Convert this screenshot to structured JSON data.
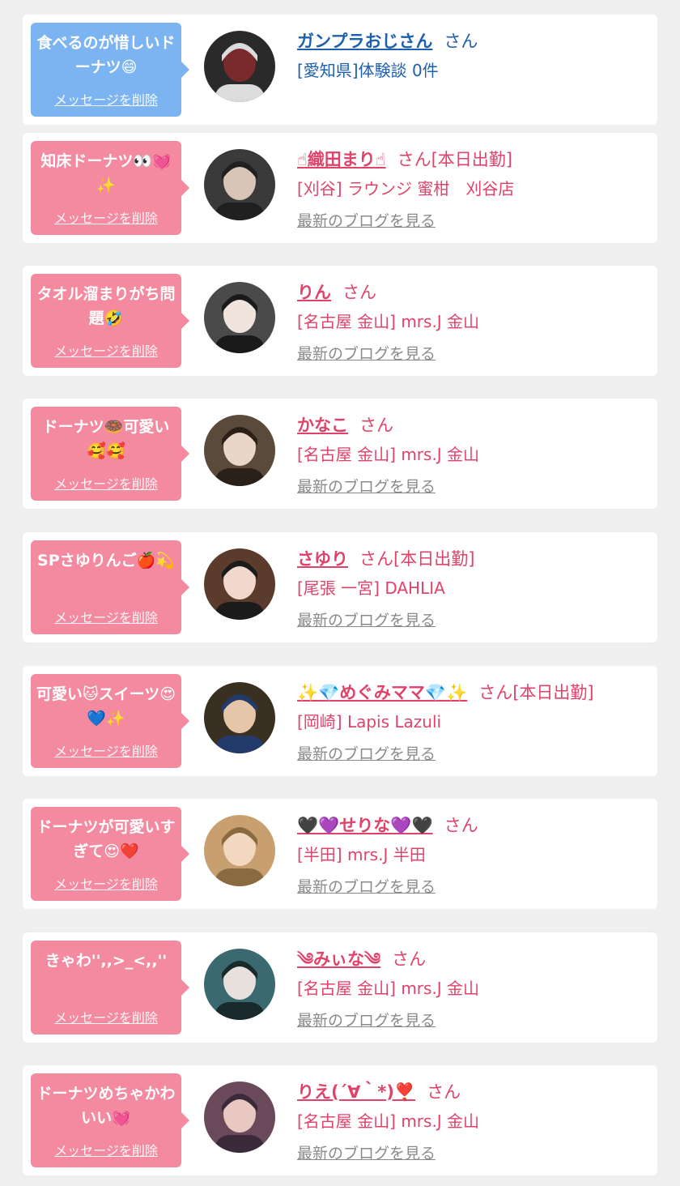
{
  "delete_label": "メッセージを削除",
  "blog_label": "最新のブログを見る",
  "colors": {
    "blue_bubble": "#7cb4f2",
    "pink_bubble": "#f48aa0",
    "blue_text": "#1f5fb0",
    "pink_text": "#e0436a",
    "muted_link": "#8a8a8a",
    "background": "#efefef"
  },
  "items": [
    {
      "bubble_text": "食べるのが惜しいドーナツ😄",
      "bubble_color": "blue",
      "name": "ガンプラおじさん",
      "name_suffix": "さん",
      "shop": "[愛知県]体験談 0件",
      "has_blog": false,
      "avatar_icon": "robot-avatar"
    },
    {
      "bubble_text": "知床ドーナツ👀💓✨",
      "bubble_color": "pink",
      "name": "☝織田まり☝",
      "name_suffix": "さん[本日出勤]",
      "shop": "[刈谷] ラウンジ 蜜柑　刈谷店",
      "has_blog": true,
      "avatar_icon": "woman-avatar"
    },
    {
      "bubble_text": "タオル溜まりがち問題🤣",
      "bubble_color": "pink",
      "name": "りん",
      "name_suffix": "さん",
      "shop": "[名古屋 金山] mrs.J 金山",
      "has_blog": true,
      "avatar_icon": "woman-avatar"
    },
    {
      "bubble_text": "ドーナツ🍩可愛い🥰🥰",
      "bubble_color": "pink",
      "name": "かなこ",
      "name_suffix": "さん",
      "shop": "[名古屋 金山] mrs.J 金山",
      "has_blog": true,
      "avatar_icon": "woman-avatar"
    },
    {
      "bubble_text": "SPさゆりんご🍎💫",
      "bubble_color": "pink",
      "name": "さゆり",
      "name_suffix": "さん[本日出勤]",
      "shop": "[尾張 一宮] DAHLIA",
      "has_blog": true,
      "avatar_icon": "woman-avatar"
    },
    {
      "bubble_text": "可愛い🐱スイーツ😍💙✨",
      "bubble_color": "pink",
      "name": "✨💎めぐみママ💎✨",
      "name_suffix": "さん[本日出勤]",
      "shop": "[岡崎] Lapis Lazuli",
      "has_blog": true,
      "avatar_icon": "woman-avatar"
    },
    {
      "bubble_text": "ドーナツが可愛いすぎて😍❤️",
      "bubble_color": "pink",
      "name": "🖤💜せりな💜🖤",
      "name_suffix": "さん",
      "shop": "[半田] mrs.J 半田",
      "has_blog": true,
      "avatar_icon": "woman-avatar"
    },
    {
      "bubble_text": "きゃわ'',,>_<,,''",
      "bubble_color": "pink",
      "name": "༄みぃな༄",
      "name_suffix": "さん",
      "shop": "[名古屋 金山] mrs.J 金山",
      "has_blog": true,
      "avatar_icon": "woman-avatar"
    },
    {
      "bubble_text": "ドーナツめちゃかわいい💓",
      "bubble_color": "pink",
      "name": "りえ(´∀｀*)❣️",
      "name_suffix": "さん",
      "shop": "[名古屋 金山] mrs.J 金山",
      "has_blog": true,
      "avatar_icon": "woman-avatar"
    }
  ]
}
